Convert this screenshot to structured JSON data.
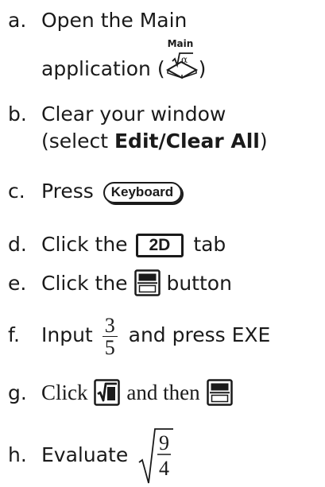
{
  "steps": {
    "a": {
      "letter": "a.",
      "line1": "Open the Main",
      "line2_pre": "application (",
      "line2_post": ")",
      "icon_label": "Main",
      "icon_name": "main-app-icon"
    },
    "b": {
      "letter": "b.",
      "line1": "Clear your window",
      "line2_pre": "(select ",
      "bold": "Edit/Clear All",
      "line2_post": ")"
    },
    "c": {
      "letter": "c.",
      "text": "Press",
      "button": "Keyboard"
    },
    "d": {
      "letter": "d.",
      "pre": "Click the",
      "tab": "2D",
      "post": "tab"
    },
    "e": {
      "letter": "e.",
      "pre": "Click the",
      "post": "button",
      "icon_name": "fraction-template-icon"
    },
    "f": {
      "letter": "f.",
      "pre": "Input",
      "numerator": "3",
      "denominator": "5",
      "post": "and press EXE"
    },
    "g": {
      "letter": "g.",
      "pre": "Click",
      "mid": "and then",
      "icon1_name": "square-root-icon",
      "icon2_name": "fraction-template-icon"
    },
    "h": {
      "letter": "h.",
      "pre": "Evaluate",
      "numerator": "9",
      "denominator": "4"
    }
  }
}
